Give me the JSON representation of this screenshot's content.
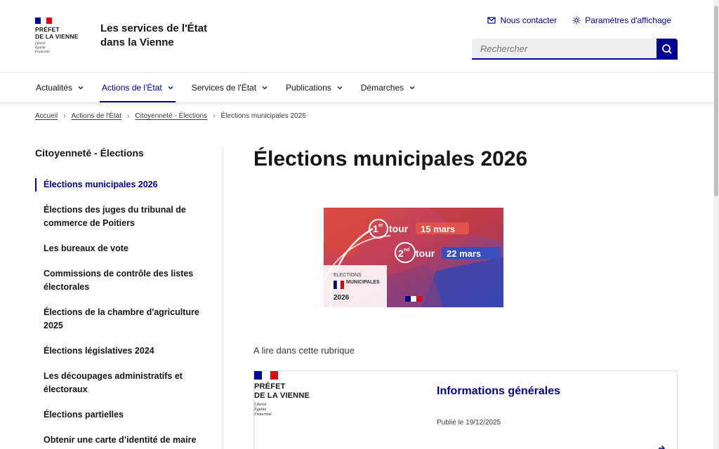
{
  "header": {
    "logo": {
      "line1": "PRÉFET",
      "line2": "DE LA VIENNE",
      "motto1": "Liberté",
      "motto2": "Égalité",
      "motto3": "Fraternité"
    },
    "site_title": "Les services de l'État dans la Vienne",
    "tools": {
      "contact": "Nous contacter",
      "display": "Paramètres d'affichage"
    },
    "search": {
      "placeholder": "Rechercher",
      "icon": "search-icon"
    }
  },
  "nav": {
    "items": [
      {
        "label": "Actualités"
      },
      {
        "label": "Actions de l'État"
      },
      {
        "label": "Services de l'État"
      },
      {
        "label": "Publications"
      },
      {
        "label": "Démarches"
      }
    ]
  },
  "breadcrumb": {
    "items": [
      "Accueil",
      "Actions de l'État",
      "Citoyenneté - Élections"
    ],
    "current": "Élections municipales 2026"
  },
  "sidebar": {
    "title": "Citoyenneté - Élections",
    "items": [
      "Élections municipales 2026",
      "Élections des juges du tribunal de commerce de Poitiers",
      "Les bureaux de vote",
      "Commissions de contrôle des listes électorales",
      "Élections de la chambre d'agriculture 2025",
      "Élections législatives 2024",
      "Les découpages administratifs et électoraux",
      "Élections partielles",
      "Obtenir une carte d’identité de maire"
    ]
  },
  "main": {
    "title": "Élections municipales 2026",
    "banner": {
      "tour1_num": "1",
      "tour1_sup": "er",
      "tour1_word": "tour",
      "tour1_date": "15 mars",
      "tour2_num": "2",
      "tour2_sup": "nd",
      "tour2_word": "tour",
      "tour2_date": "22 mars",
      "label1": "ELECTIONS",
      "label2": "MUNICIPALES",
      "year": "2026"
    },
    "rubric_label": "A lire dans cette rubrique",
    "card": {
      "logo_line1": "PRÉFET",
      "logo_line2": "DE LA VIENNE",
      "motto1": "Liberté",
      "motto2": "Égalité",
      "motto3": "Fraternité",
      "title": "Informations générales",
      "date": "Publié le 19/12/2025"
    }
  },
  "colors": {
    "primary": "#000091",
    "flag_blue": "#000091",
    "flag_white": "#ffffff",
    "flag_red": "#e1000f",
    "banner_red": "#d63b3b",
    "banner_blue": "#3a4dbf"
  }
}
